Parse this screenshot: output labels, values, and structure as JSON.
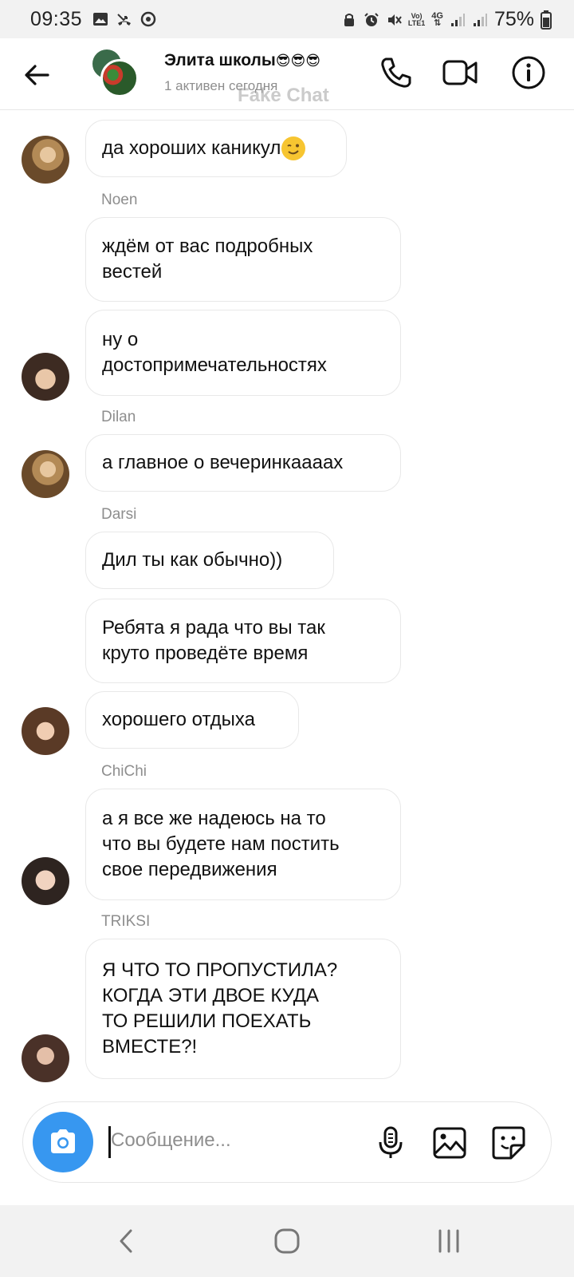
{
  "status_bar": {
    "time": "09:35",
    "network_top": "Vo)",
    "network_bottom": "LTE1",
    "network_gen": "4G",
    "battery": "75%"
  },
  "header": {
    "title": "Элита школы",
    "title_emoji": "😎😎😎",
    "subtitle": "1 активен сегодня",
    "watermark": "Fake Chat",
    "icons": [
      "back-arrow-icon",
      "phone-icon",
      "video-call-icon",
      "info-icon"
    ]
  },
  "messages": [
    {
      "text": "да хороших каникул",
      "emoji": "wink"
    },
    {
      "sender": "Noen"
    },
    {
      "text": "ждём от вас подробных\nвестей"
    },
    {
      "text": "ну о\nдостопримечательностях"
    },
    {
      "sender": "Dilan"
    },
    {
      "text": "а главное о вечеринкаааах"
    },
    {
      "sender": "Darsi"
    },
    {
      "text": "Дил ты как обычно))"
    },
    {
      "text": "Ребята я рада что вы так\nкруто проведёте время"
    },
    {
      "text": "хорошего отдыха"
    },
    {
      "sender": "ChiChi"
    },
    {
      "text": "а я все же надеюсь на то\nчто вы будете нам постить\nсвое передвижения"
    },
    {
      "sender": "TRIKSI"
    },
    {
      "text": "Я ЧТО ТО ПРОПУСТИЛА?\nКОГДА ЭТИ ДВОЕ КУДА\nТО РЕШИЛИ ПОЕХАТЬ\nВМЕСТЕ?!"
    }
  ],
  "composer": {
    "placeholder": "Сообщение...",
    "icons": [
      "camera-icon",
      "microphone-icon",
      "gallery-icon",
      "sticker-icon"
    ]
  },
  "colors": {
    "accent": "#3797f0",
    "bubble_border": "#e8e8e8",
    "secondary_text": "#8e8e8e"
  }
}
